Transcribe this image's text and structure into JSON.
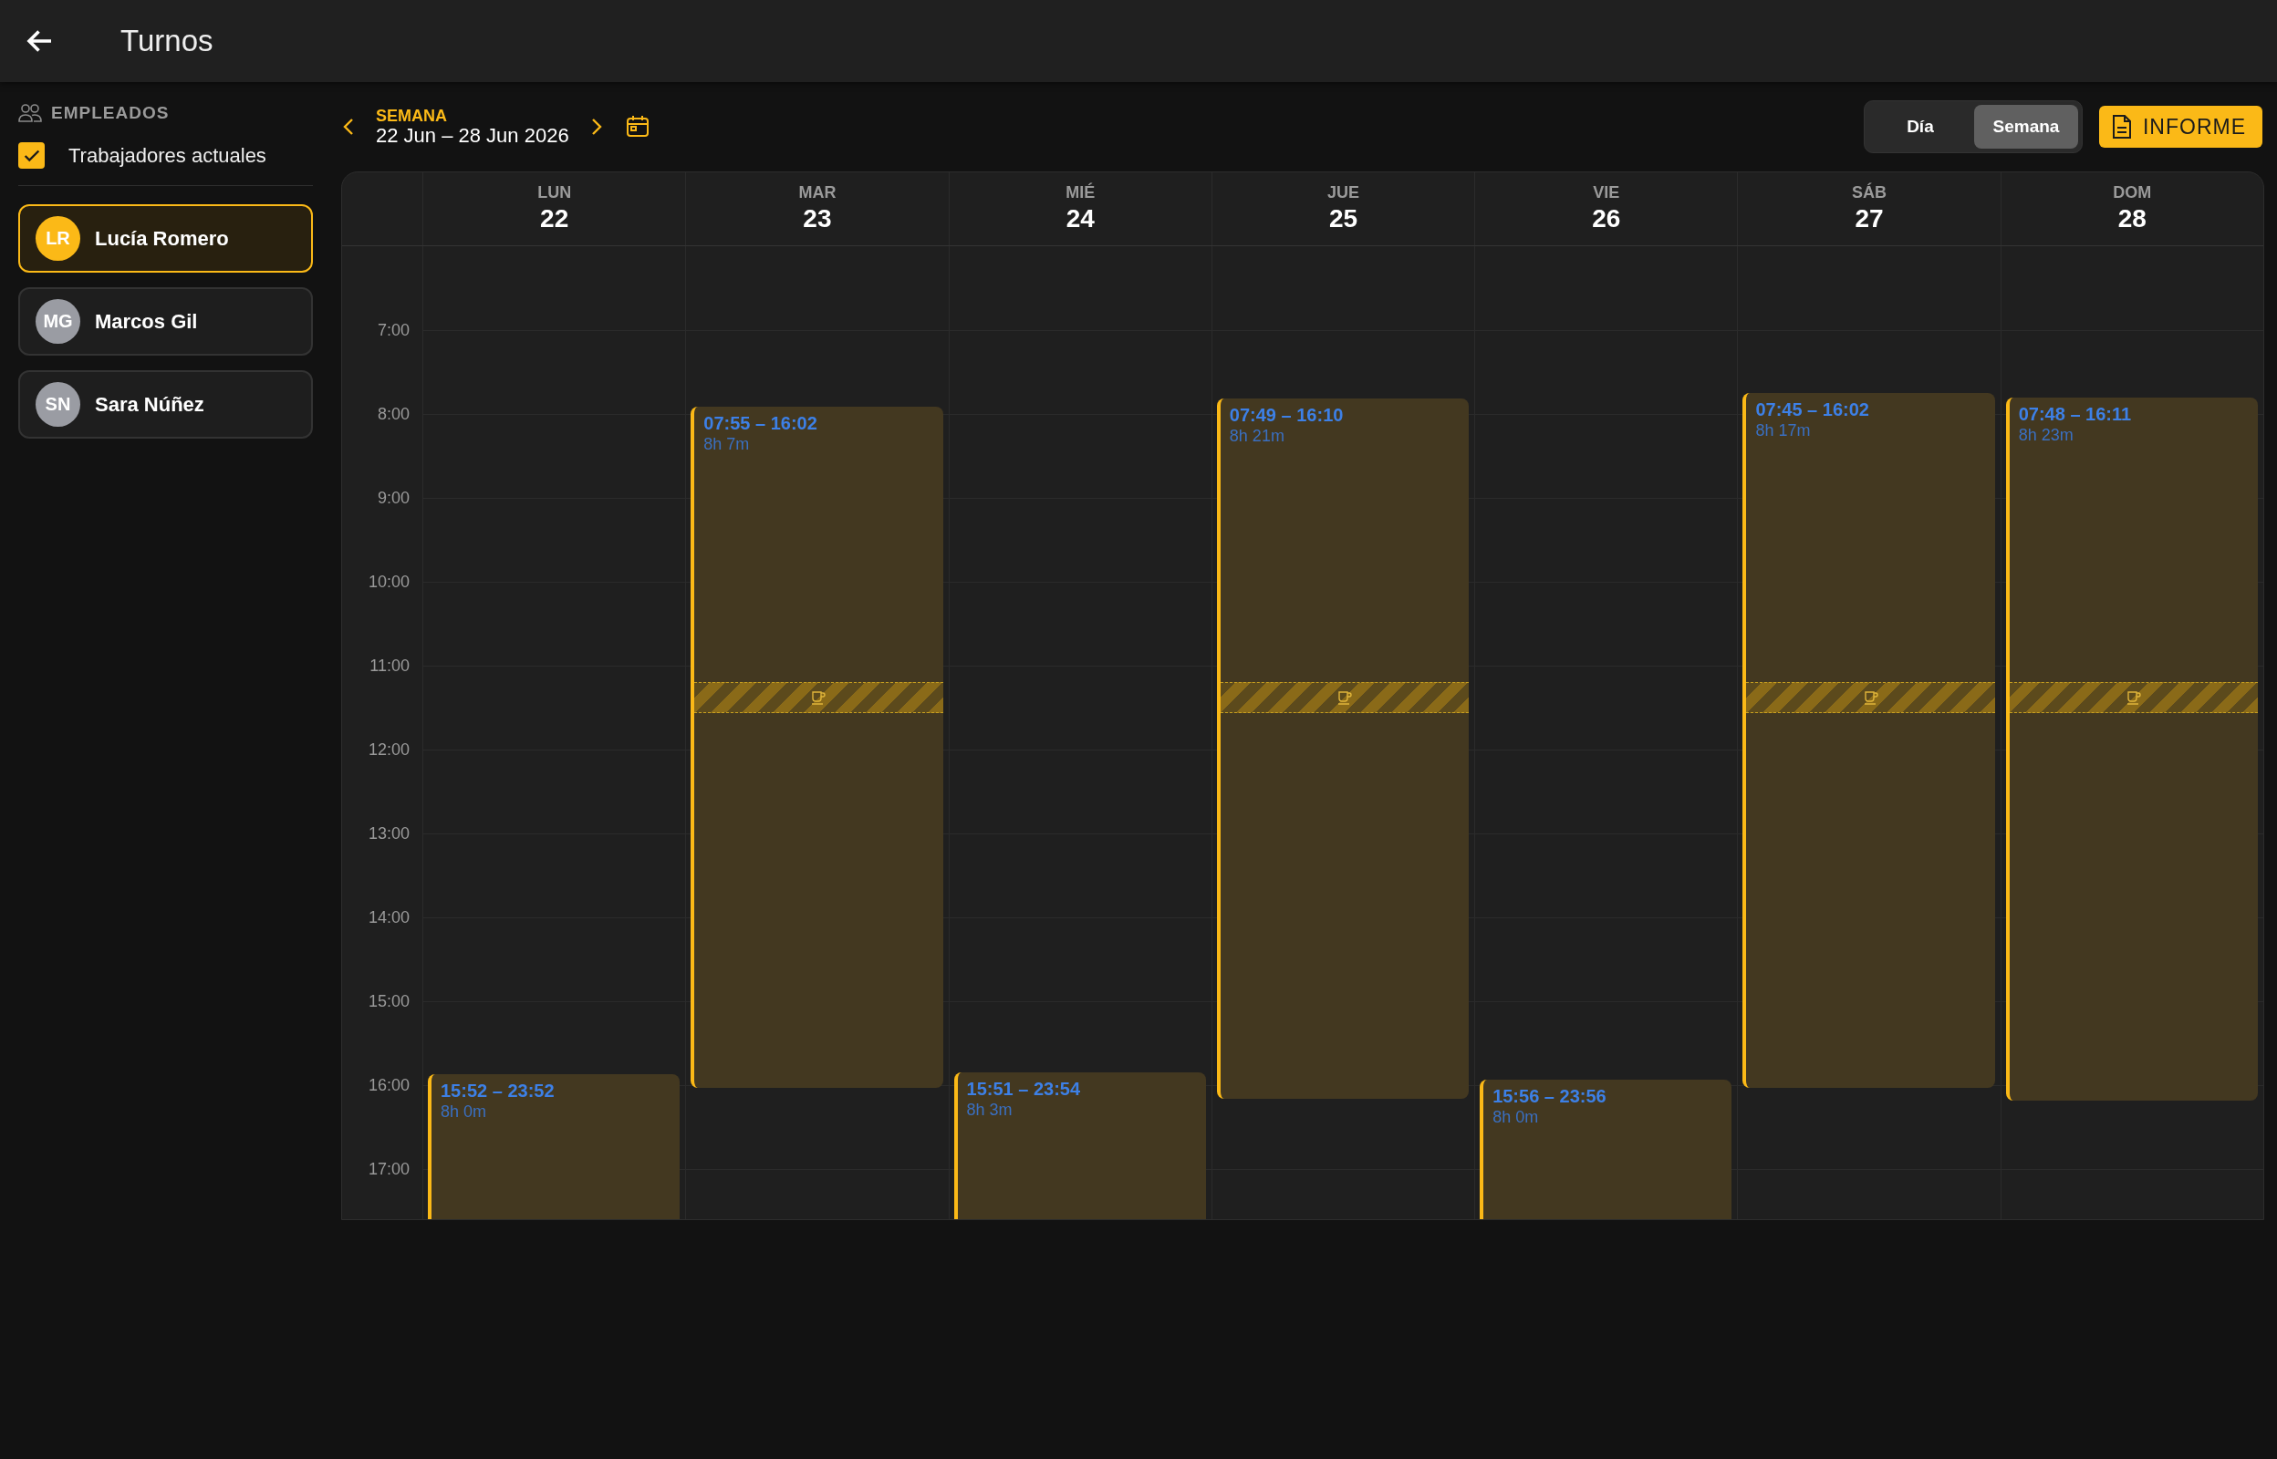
{
  "app_bar": {
    "title": "Turnos"
  },
  "sidebar": {
    "heading": "EMPLEADOS",
    "filter": {
      "label": "Trabajadores actuales",
      "checked": true
    },
    "employees": [
      {
        "initials": "LR",
        "name": "Lucía Romero",
        "selected": true
      },
      {
        "initials": "MG",
        "name": "Marcos Gil",
        "selected": false
      },
      {
        "initials": "SN",
        "name": "Sara Núñez",
        "selected": false
      }
    ]
  },
  "toolbar": {
    "period_label": "SEMANA",
    "range": "22 Jun – 28 Jun 2026",
    "views": [
      {
        "label": "Día",
        "selected": false
      },
      {
        "label": "Semana",
        "selected": true
      }
    ],
    "report_button": "INFORME"
  },
  "calendar": {
    "hours": [
      "7:00",
      "8:00",
      "9:00",
      "10:00",
      "11:00",
      "12:00",
      "13:00",
      "14:00",
      "15:00",
      "16:00",
      "17:00"
    ],
    "days": [
      {
        "name": "LUN",
        "number": "22",
        "shifts": [
          {
            "time": "15:52 – 23:52",
            "duration": "8h 0m"
          }
        ]
      },
      {
        "name": "MAR",
        "number": "23",
        "shifts": [
          {
            "time": "07:55 – 16:02",
            "duration": "8h 7m",
            "break": true
          }
        ]
      },
      {
        "name": "MIÉ",
        "number": "24",
        "shifts": [
          {
            "time": "15:51 – 23:54",
            "duration": "8h 3m"
          }
        ]
      },
      {
        "name": "JUE",
        "number": "25",
        "shifts": [
          {
            "time": "07:49 – 16:10",
            "duration": "8h 21m",
            "break": true
          }
        ]
      },
      {
        "name": "VIE",
        "number": "26",
        "shifts": [
          {
            "time": "15:56 – 23:56",
            "duration": "8h 0m"
          }
        ]
      },
      {
        "name": "SÁB",
        "number": "27",
        "shifts": [
          {
            "time": "07:45 – 16:02",
            "duration": "8h 17m",
            "break": true
          }
        ]
      },
      {
        "name": "DOM",
        "number": "28",
        "shifts": [
          {
            "time": "07:48 – 16:11",
            "duration": "8h 23m",
            "break": true
          }
        ]
      }
    ]
  }
}
